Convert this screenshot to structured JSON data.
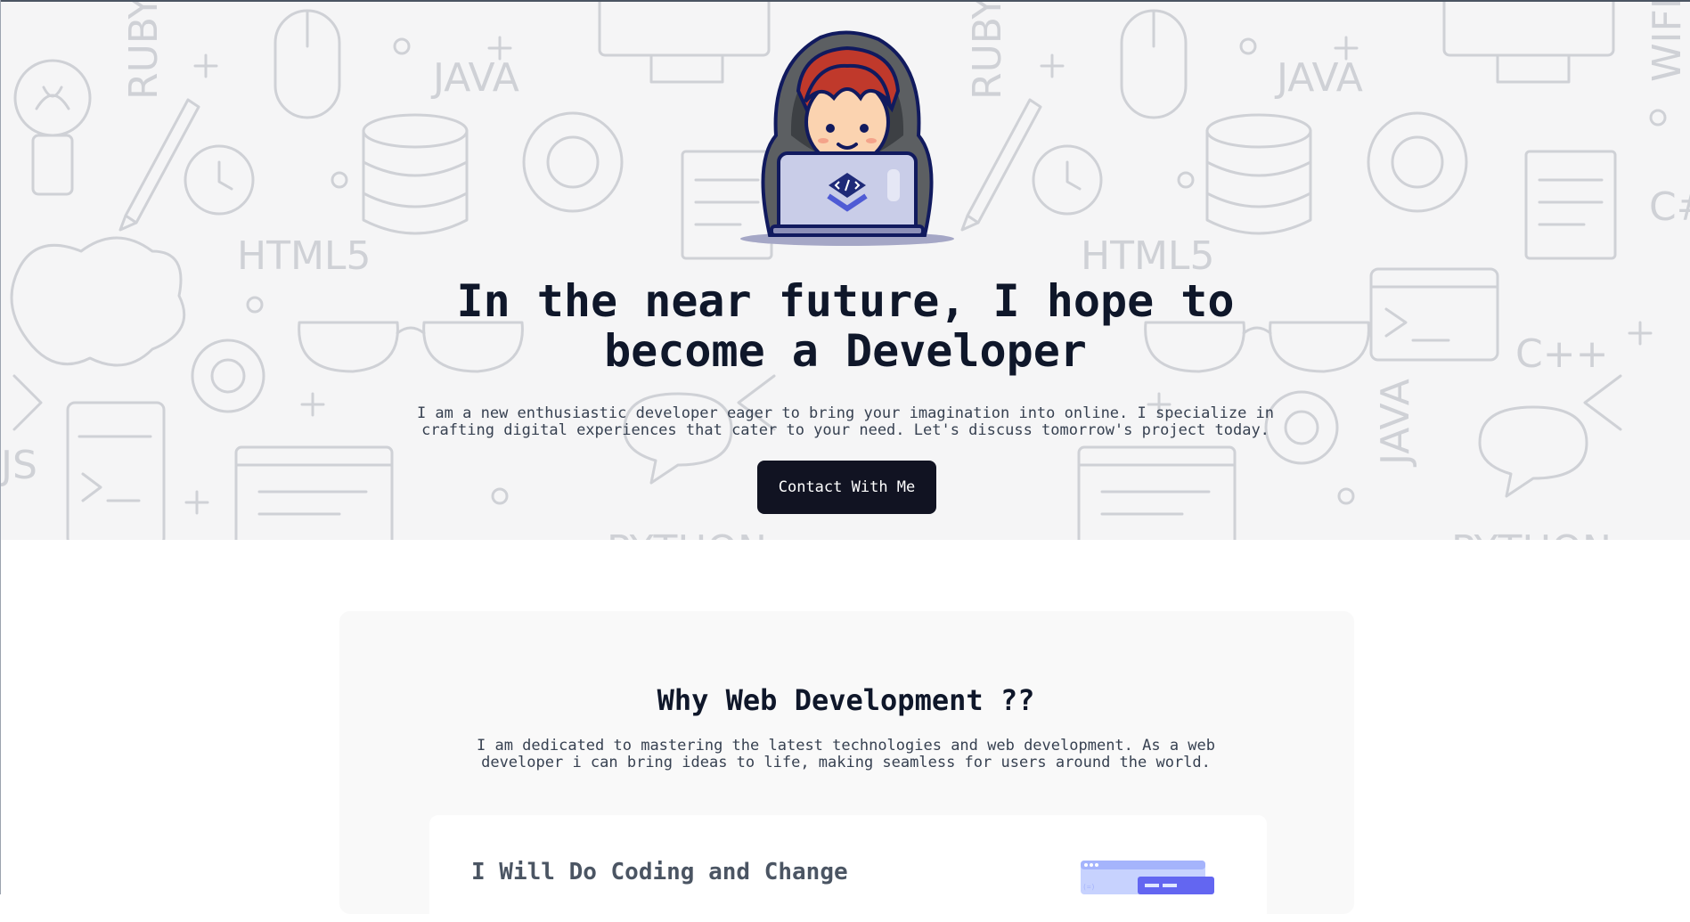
{
  "hero": {
    "title": "In the near future, I hope to become a Developer",
    "description": "I am a new enthusiastic developer eager to bring your imagination into online. I specialize in crafting digital experiences that cater to your need. Let's discuss tomorrow's project today.",
    "contact_button": "Contact With Me",
    "doodle_words": {
      "ruby": "RUBY",
      "java": "JAVA",
      "html5": "HTML5",
      "cpp": "C++",
      "csharp": "C#",
      "js": "JS",
      "python": "PYTHON",
      "wifi": "WIFI"
    }
  },
  "why": {
    "title": "Why Web Development ??",
    "description": "I am dedicated to mastering the latest technologies and web development. As a web developer i can bring ideas to life, making seamless for users around the world.",
    "card": {
      "title": "I Will Do Coding and Change"
    }
  },
  "colors": {
    "accent": "#111322",
    "doodle": "#cfd1d6",
    "hero_bg": "#f5f5f6",
    "section_bg": "#f9f9f9"
  }
}
